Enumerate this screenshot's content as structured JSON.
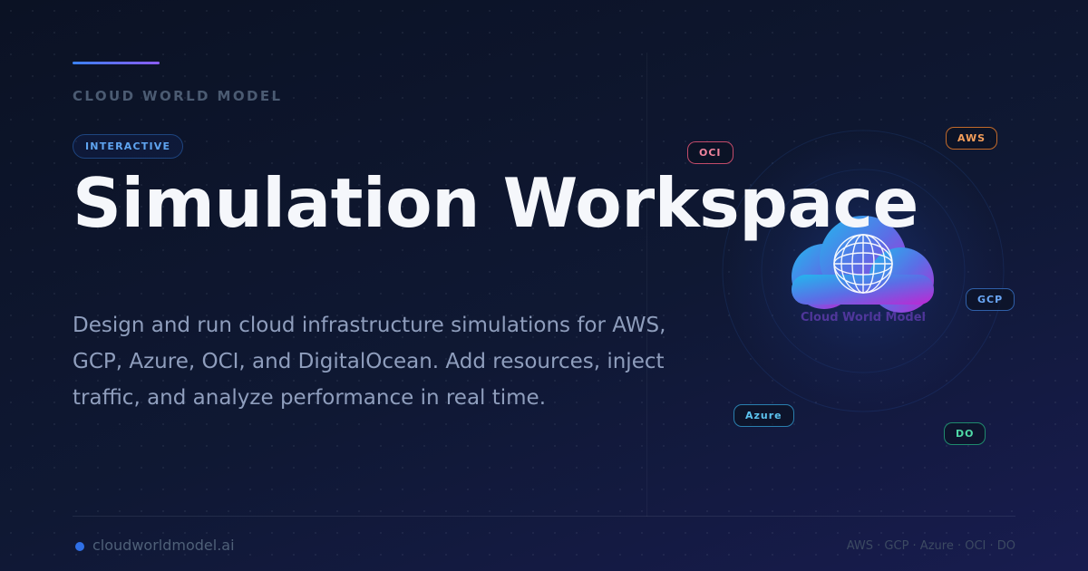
{
  "header": {
    "eyebrow": "CLOUD WORLD MODEL",
    "tag": "INTERACTIVE",
    "title": "Simulation Workspace",
    "description": "Design and run cloud infrastructure simulations for AWS, GCP, Azure, OCI, and DigitalOcean. Add resources, inject traffic, and analyze performance in real time."
  },
  "logo": {
    "icon": "cloud-globe-icon",
    "caption": "Cloud World Model"
  },
  "providers": {
    "oci": "OCI",
    "aws": "AWS",
    "gcp": "GCP",
    "azure": "Azure",
    "do": "DO"
  },
  "footer": {
    "site": "cloudworldmodel.ai",
    "providers_line": "AWS · GCP · Azure · OCI · DO"
  },
  "colors": {
    "background": "#0f1833",
    "accent_blue": "#3b82f6",
    "accent_purple": "#8b5cf6",
    "oci": "#f0849d",
    "aws": "#f59e5a",
    "gcp": "#6aa6f5",
    "azure": "#5cc3ef",
    "do": "#4fd9a6"
  }
}
